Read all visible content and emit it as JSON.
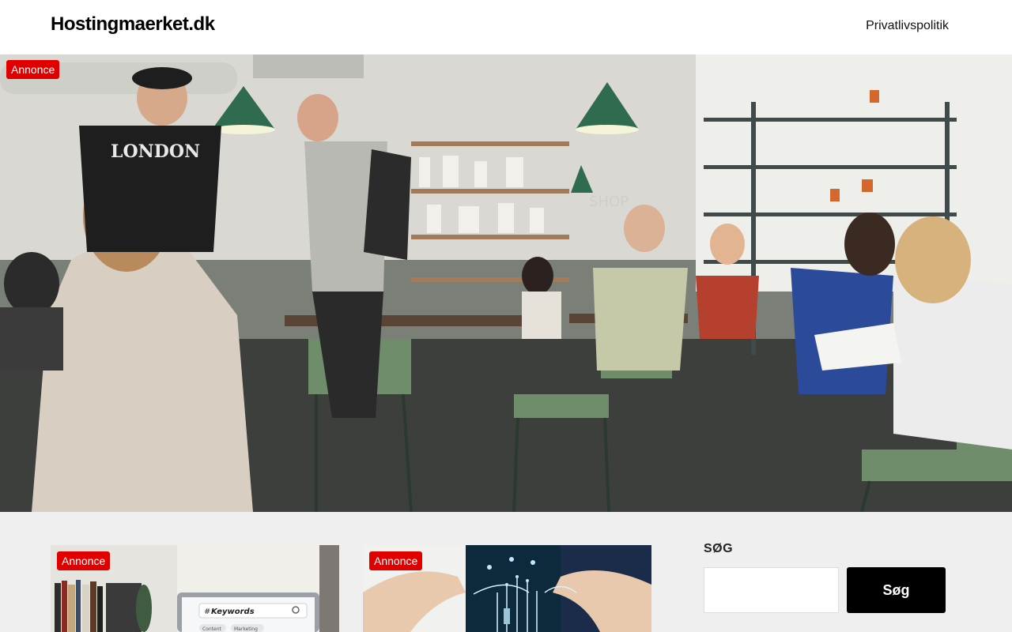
{
  "header": {
    "site_title": "Hostingmaerket.dk",
    "nav": [
      {
        "label": "Privatlivspolitik"
      }
    ]
  },
  "hero": {
    "badge": "Annonce",
    "shirt_text": "LONDON",
    "sign_text": "SHOP"
  },
  "cards": [
    {
      "badge": "Annonce",
      "screen_text": "Keywords",
      "tags": [
        "Content",
        "Marketing"
      ]
    },
    {
      "badge": "Annonce"
    }
  ],
  "sidebar": {
    "search_heading": "SØG",
    "search_value": "",
    "search_placeholder": "",
    "search_button": "Søg"
  },
  "colors": {
    "badge_red": "#e10000",
    "button_black": "#000000",
    "page_bg": "#efefef"
  }
}
